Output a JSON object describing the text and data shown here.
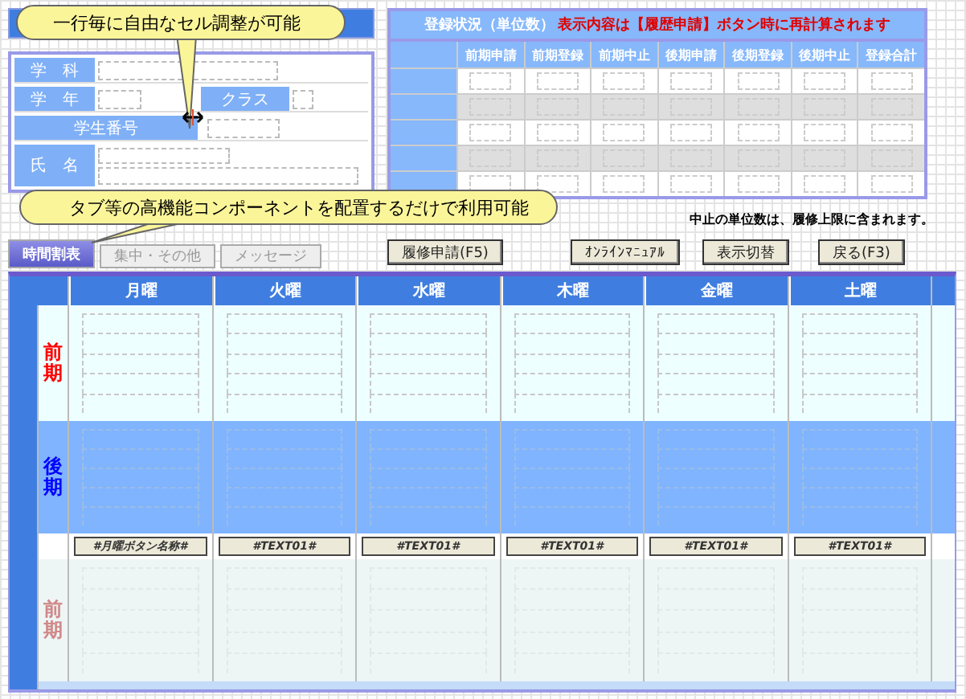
{
  "callouts": [
    {
      "text": "一行毎に自由なセル調整が可能"
    },
    {
      "text": "タブ等の高機能コンポーネントを配置するだけで利用可能"
    }
  ],
  "student_form": {
    "department_label": "学　科",
    "year_label": "学　年",
    "class_label": "クラス",
    "student_number_label": "学生番号",
    "name_label": "氏　名"
  },
  "registration": {
    "title": "登録状況（単位数）",
    "notice": "表示内容は【履歴申請】ボタン時に再計算されます",
    "columns": [
      "前期申請",
      "前期登録",
      "前期中止",
      "後期申請",
      "後期登録",
      "後期中止",
      "登録合計"
    ],
    "row_count_shown": [
      {
        "shaded": false
      },
      {
        "shaded": true
      },
      {
        "shaded": false
      },
      {
        "shaded": true
      },
      {
        "shaded": false
      }
    ]
  },
  "note": "中止の単位数は、履修上限に含まれます。",
  "tabs": [
    {
      "label": "時間割表",
      "selected": true
    },
    {
      "label": "集中・その他",
      "selected": false
    },
    {
      "label": "メッセージ",
      "selected": false
    }
  ],
  "buttons": [
    {
      "label": "履修申請(F5)"
    },
    {
      "label": "ｵﾝﾗｲﾝﾏﾆｭｱﾙ"
    },
    {
      "label": "表示切替"
    },
    {
      "label": "戻る(F3)"
    }
  ],
  "timetable": {
    "days": [
      "月曜",
      "火曜",
      "水曜",
      "木曜",
      "金曜",
      "土曜"
    ],
    "periods": [
      {
        "label": "前期",
        "color": "#ff0000",
        "kind": "normal"
      },
      {
        "label": "後期",
        "color": "#0000ff",
        "kind": "highlight"
      },
      {
        "label": "前期",
        "color": "#d08888",
        "kind": "faded"
      }
    ],
    "day_buttons": [
      "#月曜ボタン名称#",
      "#TEXT01#",
      "#TEXT01#",
      "#TEXT01#",
      "#TEXT01#",
      "#TEXT01#"
    ]
  }
}
